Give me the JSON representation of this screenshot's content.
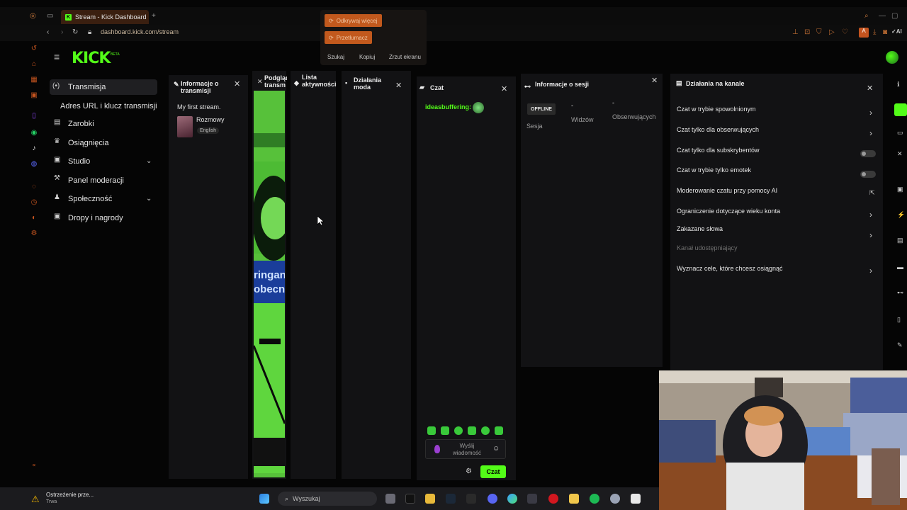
{
  "browser": {
    "tab_title": "Stream - Kick Dashboard",
    "new_tab": "+",
    "url": "dashboard.kick.com/stream",
    "logo_letter": "K"
  },
  "popup": {
    "discover_label": "Odkrywaj więcej",
    "translate_label": "Przetłumacz",
    "search_label": "Szukaj",
    "copy_label": "Kopiuj",
    "screenshot_label": "Zrzut ekranu"
  },
  "kick": {
    "logo": "KICK",
    "logo_sup": "BETA"
  },
  "sidebar": {
    "items": [
      {
        "label": "Transmisja",
        "icon": "broadcast-icon"
      },
      {
        "label": "Adres URL i klucz transmisji",
        "icon": ""
      },
      {
        "label": "Zarobki",
        "icon": "earnings-icon"
      },
      {
        "label": "Osiągnięcia",
        "icon": "trophy-icon"
      },
      {
        "label": "Studio",
        "icon": "studio-icon"
      },
      {
        "label": "Panel moderacji",
        "icon": "moderation-icon"
      },
      {
        "label": "Społeczność",
        "icon": "community-icon"
      },
      {
        "label": "Dropy i nagrody",
        "icon": "gift-icon"
      }
    ]
  },
  "columns": {
    "stream_info": {
      "title": "Informacje o transmisji",
      "stream_title": "My first stream.",
      "category": "Rozmowy",
      "language": "English"
    },
    "preview": {
      "title": "Podgląd transm",
      "overlay_text_1": "ringan",
      "overlay_text_2": "obecn"
    },
    "activity": {
      "title": "Lista aktywności"
    },
    "mod_actions": {
      "title": "Działania moda"
    },
    "chat": {
      "title": "Czat",
      "username": "ideasbuffering:",
      "input_placeholder": "Wyślij wiadomość",
      "send_label": "Czat"
    },
    "session": {
      "title": "Informacje o sesji",
      "status": "OFFLINE",
      "session_label": "Sesja",
      "viewers_value": "-",
      "viewers_label": "Widzów",
      "followers_value": "-",
      "followers_label": "Obserwujących"
    },
    "channel_actions": {
      "title": "Działania na kanale",
      "items": [
        {
          "label": "Czat w trybie spowolnionym",
          "control": "chevron"
        },
        {
          "label": "Czat tylko dla obserwujących",
          "control": "chevron"
        },
        {
          "label": "Czat tylko dla subskrybentów",
          "control": "toggle"
        },
        {
          "label": "Czat w trybie tylko emotek",
          "control": "toggle"
        },
        {
          "label": "Moderowanie czatu przy pomocy AI",
          "control": "external"
        },
        {
          "label": "Ograniczenie dotyczące wieku konta",
          "control": "chevron"
        },
        {
          "label": "Zakazane słowa",
          "control": "chevron"
        },
        {
          "label": "Kanał udostępniający",
          "control": "none"
        },
        {
          "label": "Wyznacz cele, które chcesz osiągnąć",
          "control": "chevron"
        }
      ]
    }
  },
  "taskbar": {
    "notification_title": "Ostrzeżenie prze...",
    "notification_sub": "Trwa",
    "search_placeholder": "Wyszukaj"
  },
  "colors": {
    "kick_green": "#53fc18",
    "browser_accent": "#c4541f",
    "panel_bg": "#121214"
  }
}
